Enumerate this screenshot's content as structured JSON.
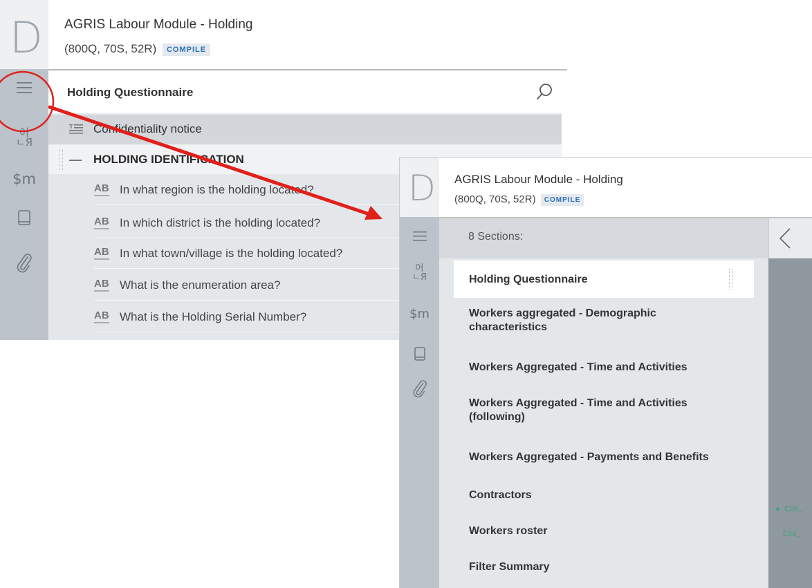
{
  "panel_a": {
    "logo_letter": "D",
    "title": "AGRIS Labour Module - Holding",
    "stats": "(800Q, 70S, 52R)",
    "compile_label": "COMPILE",
    "section_title": "Holding Questionnaire",
    "confidentiality": "Confidentiality notice",
    "section_heading": "HOLDING IDENTIFICATION",
    "questions": [
      {
        "type": "AB",
        "text": "In what region is the holding located?"
      },
      {
        "type": "AB",
        "text": "In which district is the holding located?"
      },
      {
        "type": "AB",
        "text": "In what town/village is the holding located?"
      },
      {
        "type": "AB",
        "text": "What is the enumeration area?"
      },
      {
        "type": "AB",
        "text": "What is the Holding Serial Number?"
      }
    ],
    "rail_icons": [
      "menu-icon",
      "translation-icon",
      "macros-icon",
      "lookup-table-icon",
      "attachment-icon"
    ],
    "rail_glyphs": {
      "translation": "어\nЯ",
      "macros": "$m"
    }
  },
  "panel_b": {
    "logo_letter": "D",
    "title": "AGRIS Labour Module - Holding",
    "stats": "(800Q, 70S, 52R)",
    "compile_label": "COMPILE",
    "sections_count_label": "8 Sections:",
    "sections": [
      "Holding Questionnaire",
      "Workers aggregated - Demographic characteristics",
      "Workers Aggregated - Time and Activities",
      "Workers Aggregated - Time and Activities (following)",
      "Workers Aggregated - Payments and Benefits",
      "Contractors",
      "Workers roster",
      "Filter Summary"
    ],
    "code_snippets": [
      "C26_",
      "C26_"
    ],
    "rail_glyphs": {
      "translation": "어\nЯ",
      "macros": "$m"
    }
  },
  "colors": {
    "rail": "#bcc3ca",
    "list_bg": "#e4e7ea",
    "compile_text": "#2e6fb5",
    "annotation_red": "#e0201b"
  }
}
